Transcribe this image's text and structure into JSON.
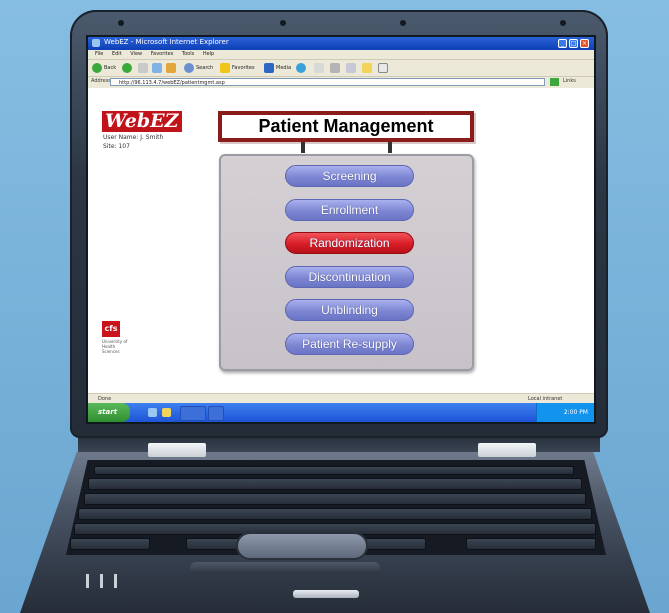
{
  "browser": {
    "title": "WebEZ - Microsoft Internet Explorer",
    "menu": [
      "File",
      "Edit",
      "View",
      "Favorites",
      "Tools",
      "Help"
    ],
    "toolbar": {
      "back": "Back",
      "search": "Search",
      "favorites": "Favorites",
      "media": "Media"
    },
    "address_label": "Address",
    "address": "http://96.113.4.7/webEZ/patientmgmt.asp",
    "links_label": "Links",
    "status_left": "Done",
    "status_right": "Local intranet"
  },
  "app": {
    "logo": "WebEZ",
    "user": "User Name: J. Smith",
    "site": "Site: 107",
    "heading": "Patient Management",
    "footer_logo": "cfs",
    "footer_text": "University of Health Sciences"
  },
  "nav": [
    {
      "label": "Screening"
    },
    {
      "label": "Enrollment"
    },
    {
      "label": "Randomization",
      "active": true
    },
    {
      "label": "Discontinuation"
    },
    {
      "label": "Unblinding"
    },
    {
      "label": "Patient Re-supply"
    }
  ],
  "taskbar": {
    "start": "start",
    "clock": "2:00 PM"
  },
  "colors": {
    "accent": "#c0141a",
    "nav_button": "#7d86d2",
    "nav_active": "#d81d26",
    "panel": "#d5d0d4"
  }
}
